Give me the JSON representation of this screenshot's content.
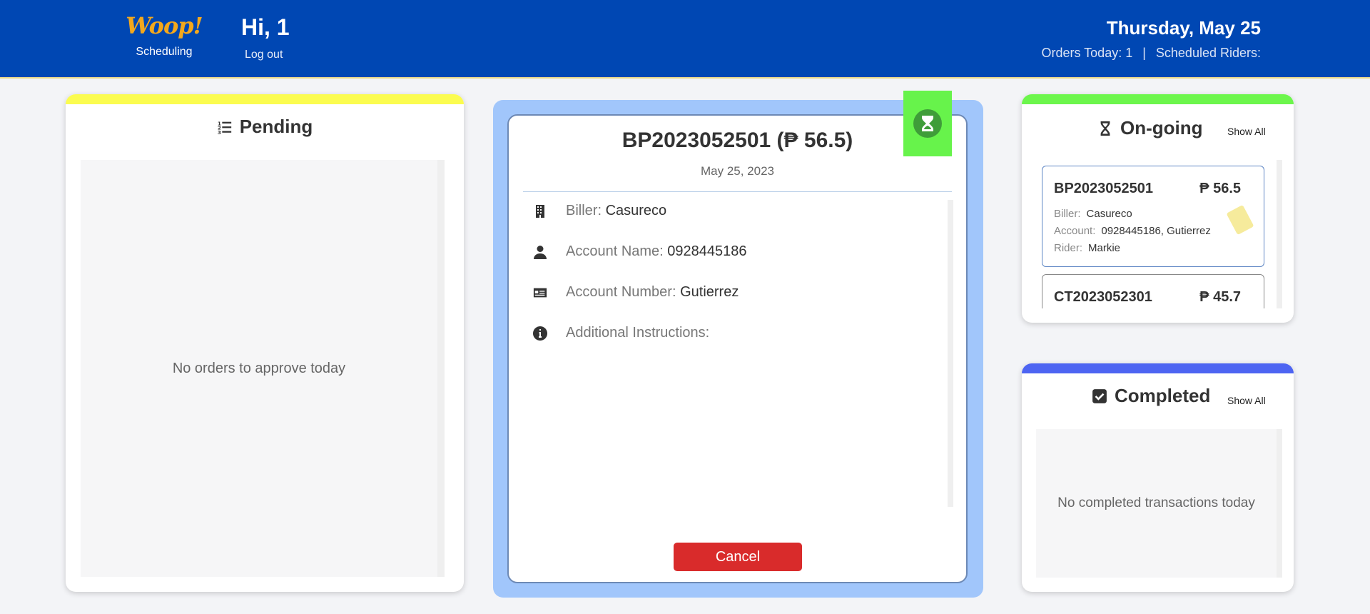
{
  "header": {
    "logo_text": "Woop!",
    "logo_subtitle": "Scheduling",
    "greeting": "Hi, 1",
    "logout_label": "Log out",
    "date": "Thursday, May 25",
    "orders_today": "Orders Today: 1",
    "separator": "|",
    "scheduled_riders": "Scheduled Riders:"
  },
  "pending": {
    "title": "Pending",
    "empty_message": "No orders to approve today",
    "accent_color": "#fbfc50"
  },
  "detail": {
    "title": "BP2023052501 (₱ 56.5)",
    "date": "May 25, 2023",
    "fields": [
      {
        "label": "Biller:",
        "value": "Casureco",
        "icon": "building-icon"
      },
      {
        "label": "Account Name:",
        "value": "0928445186",
        "icon": "user-icon"
      },
      {
        "label": "Account Number:",
        "value": "Gutierrez",
        "icon": "id-card-icon"
      },
      {
        "label": "Additional Instructions:",
        "value": "",
        "icon": "info-icon"
      }
    ],
    "cancel_label": "Cancel",
    "status_icon": "hourglass-icon",
    "status_color": "#67f34b"
  },
  "ongoing": {
    "title": "On-going",
    "show_all_label": "Show All",
    "accent_color": "#6cf64c",
    "orders": [
      {
        "id": "BP2023052501",
        "amount": "₱ 56.5",
        "biller_label": "Biller:",
        "biller": "Casureco",
        "account_label": "Account:",
        "account": "0928445186, Gutierrez",
        "rider_label": "Rider:",
        "rider": "Markie"
      },
      {
        "id": "CT2023052301",
        "amount": "₱ 45.7"
      }
    ]
  },
  "completed": {
    "title": "Completed",
    "show_all_label": "Show All",
    "empty_message": "No completed transactions today",
    "accent_color": "#4d64f2"
  }
}
